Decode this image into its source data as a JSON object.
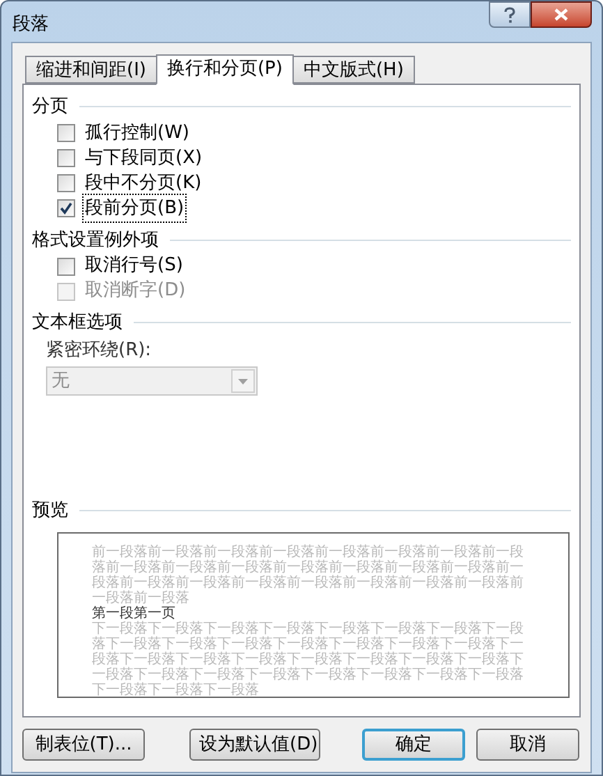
{
  "window": {
    "title": "段落"
  },
  "tabs": [
    {
      "label": "缩进和间距(I)",
      "selected": false
    },
    {
      "label": "换行和分页(P)",
      "selected": true
    },
    {
      "label": "中文版式(H)",
      "selected": false
    }
  ],
  "sections": [
    {
      "title": "分页",
      "options": [
        {
          "label": "孤行控制(W)",
          "checked": false,
          "disabled": false,
          "focused": false
        },
        {
          "label": "与下段同页(X)",
          "checked": false,
          "disabled": false,
          "focused": false
        },
        {
          "label": "段中不分页(K)",
          "checked": false,
          "disabled": false,
          "focused": false
        },
        {
          "label": "段前分页(B)",
          "checked": true,
          "disabled": false,
          "focused": true
        }
      ]
    },
    {
      "title": "格式设置例外项",
      "options": [
        {
          "label": "取消行号(S)",
          "checked": false,
          "disabled": false,
          "focused": false
        },
        {
          "label": "取消断字(D)",
          "checked": false,
          "disabled": true,
          "focused": false
        }
      ]
    },
    {
      "title": "文本框选项",
      "dropdown": {
        "label": "紧密环绕(R):",
        "value": "无",
        "disabled": true
      }
    }
  ],
  "preview": {
    "title": "预览",
    "previous_text": "前一段落前一段落前一段落前一段落前一段落前一段落前一段落前一段落前一段落前一段落前一段落前一段落前一段落前一段落前一段落前一段落前一段落前一段落前一段落前一段落前一段落前一段落前一段落前一段落前一段落",
    "current_text": "第一段第一页",
    "next_text": "下一段落下一段落下一段落下一段落下一段落下一段落下一段落下一段落下一段落下一段落下一段落下一段落下一段落下一段落下一段落下一段落下一段落下一段落下一段落下一段落下一段落下一段落下一段落下一段落下一段落下一段落下一段落下一段落下一段落下一段落下一段落下一段落下一段落下一段落"
  },
  "buttons": [
    {
      "label": "制表位(T)...",
      "default": false
    },
    {
      "label": "设为默认值(D)",
      "default": false
    },
    {
      "label": "确定",
      "default": true
    },
    {
      "label": "取消",
      "default": false
    }
  ]
}
